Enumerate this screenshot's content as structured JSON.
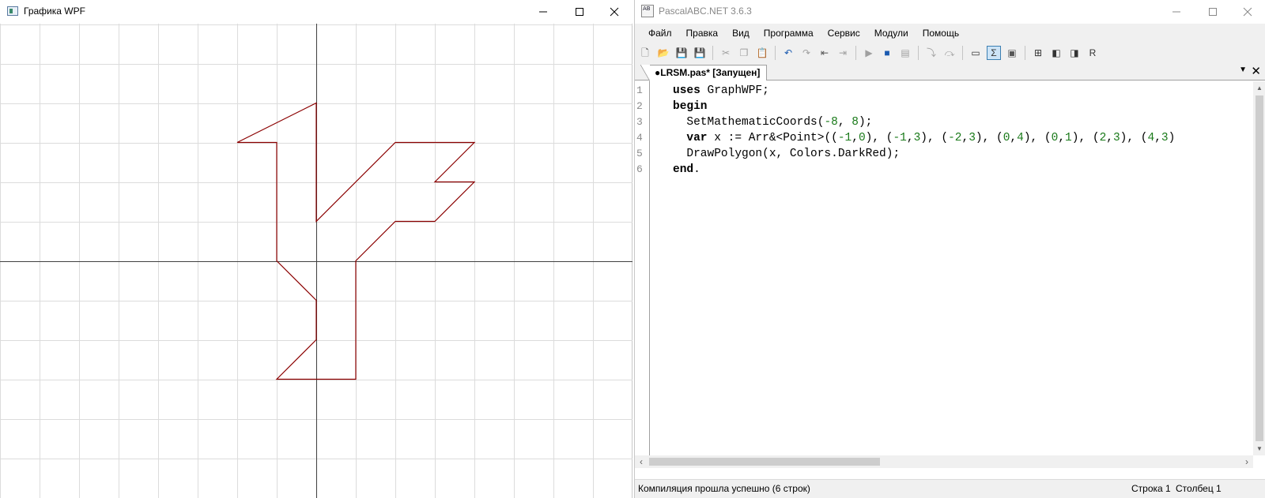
{
  "wpf_window": {
    "title": "Графика WPF",
    "buttons": {
      "minimize": "—",
      "maximize": "☐",
      "close": "✕"
    }
  },
  "graph": {
    "coord_extent": 8,
    "grid_color": "#dcdcdc",
    "axis_color": "#404040",
    "polygon_color": "#8b0000",
    "polygon": [
      [
        -1,
        0
      ],
      [
        -1,
        3
      ],
      [
        -2,
        3
      ],
      [
        0,
        4
      ],
      [
        0,
        1
      ],
      [
        2,
        3
      ],
      [
        4,
        3
      ],
      [
        3,
        2
      ],
      [
        4,
        2
      ],
      [
        3,
        1
      ],
      [
        2,
        1
      ],
      [
        1,
        0
      ],
      [
        1,
        -3
      ],
      [
        -1,
        -3
      ],
      [
        0,
        -2
      ],
      [
        0,
        -1
      ],
      [
        -1,
        0
      ]
    ]
  },
  "ide_window": {
    "title": "PascalABC.NET 3.6.3",
    "icon_text": "AB",
    "buttons": {
      "minimize": "—",
      "maximize": "☐",
      "close": "✕"
    }
  },
  "menu": [
    "Файл",
    "Правка",
    "Вид",
    "Программа",
    "Сервис",
    "Модули",
    "Помощь"
  ],
  "toolbar": {
    "icons": [
      {
        "name": "new-file-icon",
        "glyph": "🗋",
        "color": "#555"
      },
      {
        "name": "open-folder-icon",
        "glyph": "📂",
        "color": "#c89a20"
      },
      {
        "name": "save-icon",
        "glyph": "💾",
        "color": "#2a4a8a"
      },
      {
        "name": "save-all-icon",
        "glyph": "💾",
        "color": "#2a4a8a"
      },
      {
        "sep": true
      },
      {
        "name": "cut-icon",
        "glyph": "✂",
        "color": "#a0a0a0"
      },
      {
        "name": "copy-icon",
        "glyph": "❐",
        "color": "#a0a0a0"
      },
      {
        "name": "paste-icon",
        "glyph": "📋",
        "color": "#c89a20"
      },
      {
        "sep": true
      },
      {
        "name": "undo-icon",
        "glyph": "↶",
        "color": "#1a5ab0"
      },
      {
        "name": "redo-icon",
        "glyph": "↷",
        "color": "#a0a0a0"
      },
      {
        "name": "navigate-back-icon",
        "glyph": "⇤",
        "color": "#555"
      },
      {
        "name": "navigate-forward-icon",
        "glyph": "⇥",
        "color": "#a0a0a0"
      },
      {
        "sep": true
      },
      {
        "name": "run-icon",
        "glyph": "▶",
        "color": "#a0a0a0"
      },
      {
        "name": "stop-icon",
        "glyph": "■",
        "color": "#1a5ab0"
      },
      {
        "name": "compile-icon",
        "glyph": "▤",
        "color": "#a0a0a0"
      },
      {
        "sep": true
      },
      {
        "name": "step-into-icon",
        "glyph": "⤵",
        "color": "#a0a0a0"
      },
      {
        "name": "step-over-icon",
        "glyph": "⤼",
        "color": "#a0a0a0"
      },
      {
        "sep": true
      },
      {
        "name": "output-window-icon",
        "glyph": "▭",
        "color": "#333"
      },
      {
        "name": "format-code-icon",
        "glyph": "Σ",
        "color": "#333",
        "pressed": true
      },
      {
        "name": "debug-window-icon",
        "glyph": "▣",
        "color": "#555"
      },
      {
        "sep": true
      },
      {
        "name": "module-icon",
        "glyph": "⊞",
        "color": "#333"
      },
      {
        "name": "form-designer-icon",
        "glyph": "◧",
        "color": "#333"
      },
      {
        "name": "form-run-icon",
        "glyph": "◨",
        "color": "#333"
      },
      {
        "name": "reference-icon",
        "glyph": "R",
        "color": "#333"
      }
    ]
  },
  "tab": {
    "label": "●LRSM.pas* [Запущен]",
    "menu_icon": "▼",
    "close_icon": "✕"
  },
  "code": {
    "lines": [
      {
        "n": "1",
        "tokens": [
          {
            "t": "uses",
            "c": "kw"
          },
          {
            "t": " GraphWPF;"
          }
        ]
      },
      {
        "n": "2",
        "tokens": [
          {
            "t": "begin",
            "c": "kw"
          }
        ]
      },
      {
        "n": "3",
        "tokens": [
          {
            "t": "  SetMathematicCoords("
          },
          {
            "t": "-8",
            "c": "num"
          },
          {
            "t": ", "
          },
          {
            "t": "8",
            "c": "num"
          },
          {
            "t": ");"
          }
        ]
      },
      {
        "n": "4",
        "tokens": [
          {
            "t": "  "
          },
          {
            "t": "var",
            "c": "kw"
          },
          {
            "t": " x := Arr&<Point>(("
          },
          {
            "t": "-1",
            "c": "num"
          },
          {
            "t": ","
          },
          {
            "t": "0",
            "c": "num"
          },
          {
            "t": "), ("
          },
          {
            "t": "-1",
            "c": "num"
          },
          {
            "t": ","
          },
          {
            "t": "3",
            "c": "num"
          },
          {
            "t": "), ("
          },
          {
            "t": "-2",
            "c": "num"
          },
          {
            "t": ","
          },
          {
            "t": "3",
            "c": "num"
          },
          {
            "t": "), ("
          },
          {
            "t": "0",
            "c": "num"
          },
          {
            "t": ","
          },
          {
            "t": "4",
            "c": "num"
          },
          {
            "t": "), ("
          },
          {
            "t": "0",
            "c": "num"
          },
          {
            "t": ","
          },
          {
            "t": "1",
            "c": "num"
          },
          {
            "t": "), ("
          },
          {
            "t": "2",
            "c": "num"
          },
          {
            "t": ","
          },
          {
            "t": "3",
            "c": "num"
          },
          {
            "t": "), ("
          },
          {
            "t": "4",
            "c": "num"
          },
          {
            "t": ","
          },
          {
            "t": "3",
            "c": "num"
          },
          {
            "t": ")"
          }
        ]
      },
      {
        "n": "5",
        "tokens": [
          {
            "t": "  DrawPolygon(x, Colors.DarkRed);"
          }
        ]
      },
      {
        "n": "6",
        "tokens": [
          {
            "t": "end",
            "c": "kw"
          },
          {
            "t": "."
          }
        ]
      }
    ]
  },
  "scrollbars": {
    "up": "▲",
    "down": "▼",
    "left": "‹",
    "right": "›"
  },
  "status": {
    "message": "Компиляция прошла успешно (6 строк)",
    "row_label": "Строка  1",
    "col_label": "Столбец  1"
  }
}
